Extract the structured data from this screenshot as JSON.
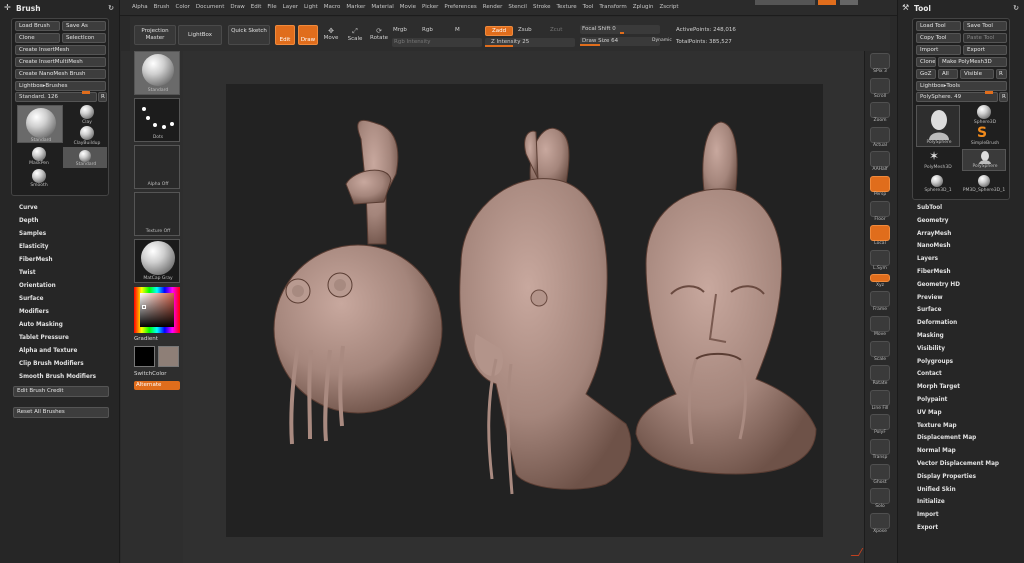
{
  "menu": [
    "Alpha",
    "Brush",
    "Color",
    "Document",
    "Draw",
    "Edit",
    "File",
    "Layer",
    "Light",
    "Macro",
    "Marker",
    "Material",
    "Movie",
    "Picker",
    "Preferences",
    "Render",
    "Stencil",
    "Stroke",
    "Texture",
    "Tool",
    "Transform",
    "Zplugin",
    "Zscript"
  ],
  "brush_panel": {
    "title": "Brush",
    "buttons": [
      [
        "Load Brush",
        "Save As"
      ],
      [
        "Clone",
        "SelectIcon"
      ]
    ],
    "wide_buttons": [
      "Create InsertMesh",
      "Create InsertMultiMesh",
      "Create NanoMesh Brush",
      "Lightbox▸Brushes"
    ],
    "current_brush_label": "Standard. 126",
    "slot_label": "R",
    "thumbs": [
      {
        "label": "Standard"
      },
      {
        "label": "Clay"
      },
      {
        "label": "ClayBuildup"
      },
      {
        "label": "MaskPen"
      },
      {
        "label": "Standard"
      },
      {
        "label": "Smooth"
      }
    ],
    "sections": [
      "Curve",
      "Depth",
      "Samples",
      "Elasticity",
      "FiberMesh",
      "Twist",
      "Orientation",
      "Surface",
      "Modifiers",
      "Auto Masking",
      "Tablet Pressure",
      "Alpha and Texture",
      "Clip Brush Modifiers",
      "Smooth Brush Modifiers"
    ],
    "footer_buttons": [
      "Edit Brush Credit",
      "Reset All Brushes"
    ]
  },
  "tray": {
    "labels": [
      "Standard",
      "Dots",
      "Alpha Off",
      "Texture Off",
      "MatCap Gray"
    ],
    "gradient_label": "Gradient",
    "switch_label": "SwitchColor",
    "alternate_label": "Alternate"
  },
  "shelf": {
    "projection_master": "Projection Master",
    "lightbox": "LightBox",
    "quick_sketch": "Quick Sketch",
    "edit": "Edit",
    "draw": "Draw",
    "move": "Move",
    "scale": "Scale",
    "rotate": "Rotate",
    "mrgb": "Mrgb",
    "rgb": "Rgb",
    "m": "M",
    "rgb_intensity": "Rgb Intensity",
    "zadd": "Zadd",
    "zsub": "Zsub",
    "zcut": "Zcut",
    "z_intensity": "Z Intensity 25",
    "focal_shift": "Focal Shift 0",
    "draw_size": "Draw Size 64",
    "dynamic": "Dynamic",
    "active_points": "ActivePoints: 248,016",
    "total_points": "TotalPoints: 385,527"
  },
  "nav": {
    "labels": [
      "SPix 3",
      "Scroll",
      "Zoom",
      "Actual",
      "AAHalf",
      "Persp",
      "Floor",
      "Local",
      "L.Sym",
      "Xyz",
      "Frame",
      "Move",
      "Scale",
      "Rotate",
      "Line Fill",
      "PolyF",
      "Transp",
      "Ghost",
      "Solo",
      "Xpose"
    ]
  },
  "tool_panel": {
    "title": "Tool",
    "buttons": [
      [
        "Load Tool",
        "Save Tool"
      ],
      [
        "Copy Tool",
        "Paste Tool"
      ],
      [
        "Import",
        "Export"
      ],
      [
        "Clone",
        "Make PolyMesh3D"
      ],
      [
        "GoZ",
        "All",
        "Visible",
        "R"
      ]
    ],
    "lightbox_tools": "Lightbox▸Tools",
    "current_tool": "PolySphere. 49",
    "slot_label": "R",
    "tools": [
      {
        "label": "PolySphere"
      },
      {
        "label": "Sphere3D"
      },
      {
        "label": "SimpleBrush"
      },
      {
        "label": "PolyMesh3D"
      },
      {
        "label": "PolySphere"
      },
      {
        "label": "Sphere3D_1"
      },
      {
        "label": "PM3D_Sphere3D_1"
      }
    ],
    "sections": [
      "SubTool",
      "Geometry",
      "ArrayMesh",
      "NanoMesh",
      "Layers",
      "FiberMesh",
      "Geometry HD",
      "Preview",
      "Surface",
      "Deformation",
      "Masking",
      "Visibility",
      "Polygroups",
      "Contact",
      "Morph Target",
      "Polypaint",
      "UV Map",
      "Texture Map",
      "Displacement Map",
      "Normal Map",
      "Vector Displacement Map",
      "Display Properties",
      "Unified Skin",
      "Initialize",
      "Import",
      "Export"
    ]
  },
  "colors": {
    "accent": "#e06d1c",
    "skin": "#a98a80",
    "panel": "#262626"
  }
}
